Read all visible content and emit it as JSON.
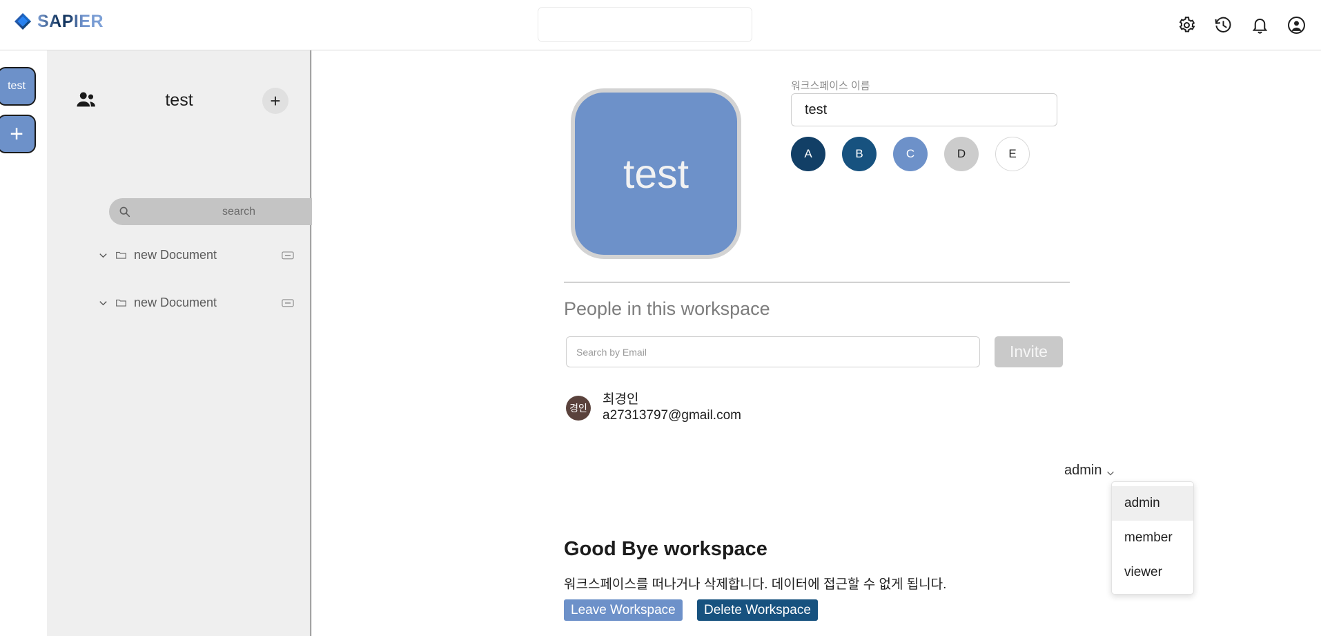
{
  "app": {
    "brand": "SAPIER",
    "brand_icon": "sapier-diamond-logo"
  },
  "topbar": {
    "search_value": "",
    "search_placeholder": "",
    "icons": [
      {
        "name": "settings-gear-icon",
        "label": "Settings"
      },
      {
        "name": "history-clock-icon",
        "label": "History"
      },
      {
        "name": "notification-bell-icon",
        "label": "Notifications"
      },
      {
        "name": "account-circle-icon",
        "label": "Account"
      }
    ]
  },
  "rail": {
    "workspaces": [
      {
        "label": "test",
        "color": "#6d91c9"
      }
    ],
    "add_label": "+"
  },
  "sidebar": {
    "people_icon": "people-group-icon",
    "title": "test",
    "add_label": "+",
    "search_value": "",
    "search_placeholder": "search",
    "documents": [
      {
        "label": "new Document"
      },
      {
        "label": "new Document"
      }
    ]
  },
  "workspace": {
    "avatar_text": "test",
    "avatar_color": "#6d91c9",
    "name_label": "워크스페이스 이름",
    "name_value": "test",
    "name_placeholder": "",
    "swatches": [
      {
        "letter": "A",
        "bg": "#123f66",
        "fg": "#ffffff",
        "border": "none"
      },
      {
        "letter": "B",
        "bg": "#17527f",
        "fg": "#ffffff",
        "border": "none"
      },
      {
        "letter": "C",
        "bg": "#6d91c9",
        "fg": "#ffffff",
        "border": "none"
      },
      {
        "letter": "D",
        "bg": "#cccccc",
        "fg": "#1f1f1f",
        "border": "none"
      },
      {
        "letter": "E",
        "bg": "#ffffff",
        "fg": "#1f1f1f",
        "border": "1px solid #d8d8d8"
      }
    ]
  },
  "people": {
    "title": "People in this workspace",
    "search_value": "",
    "search_placeholder": "Search by Email",
    "invite_label": "Invite",
    "members": [
      {
        "initials": "경인",
        "avatar_color": "#5a423c",
        "name": "최경인",
        "email": "a27313797@gmail.com",
        "role": "admin"
      }
    ],
    "role_options": [
      "admin",
      "member",
      "viewer"
    ],
    "role_selected": "admin"
  },
  "goodbye": {
    "title": "Good Bye workspace",
    "description": "워크스페이스를 떠나거나 삭제합니다. 데이터에 접근할 수 없게 됩니다.",
    "leave_label": "Leave Workspace",
    "delete_label": "Delete Workspace",
    "leave_color": "#6d91c9",
    "delete_color": "#17527f"
  }
}
